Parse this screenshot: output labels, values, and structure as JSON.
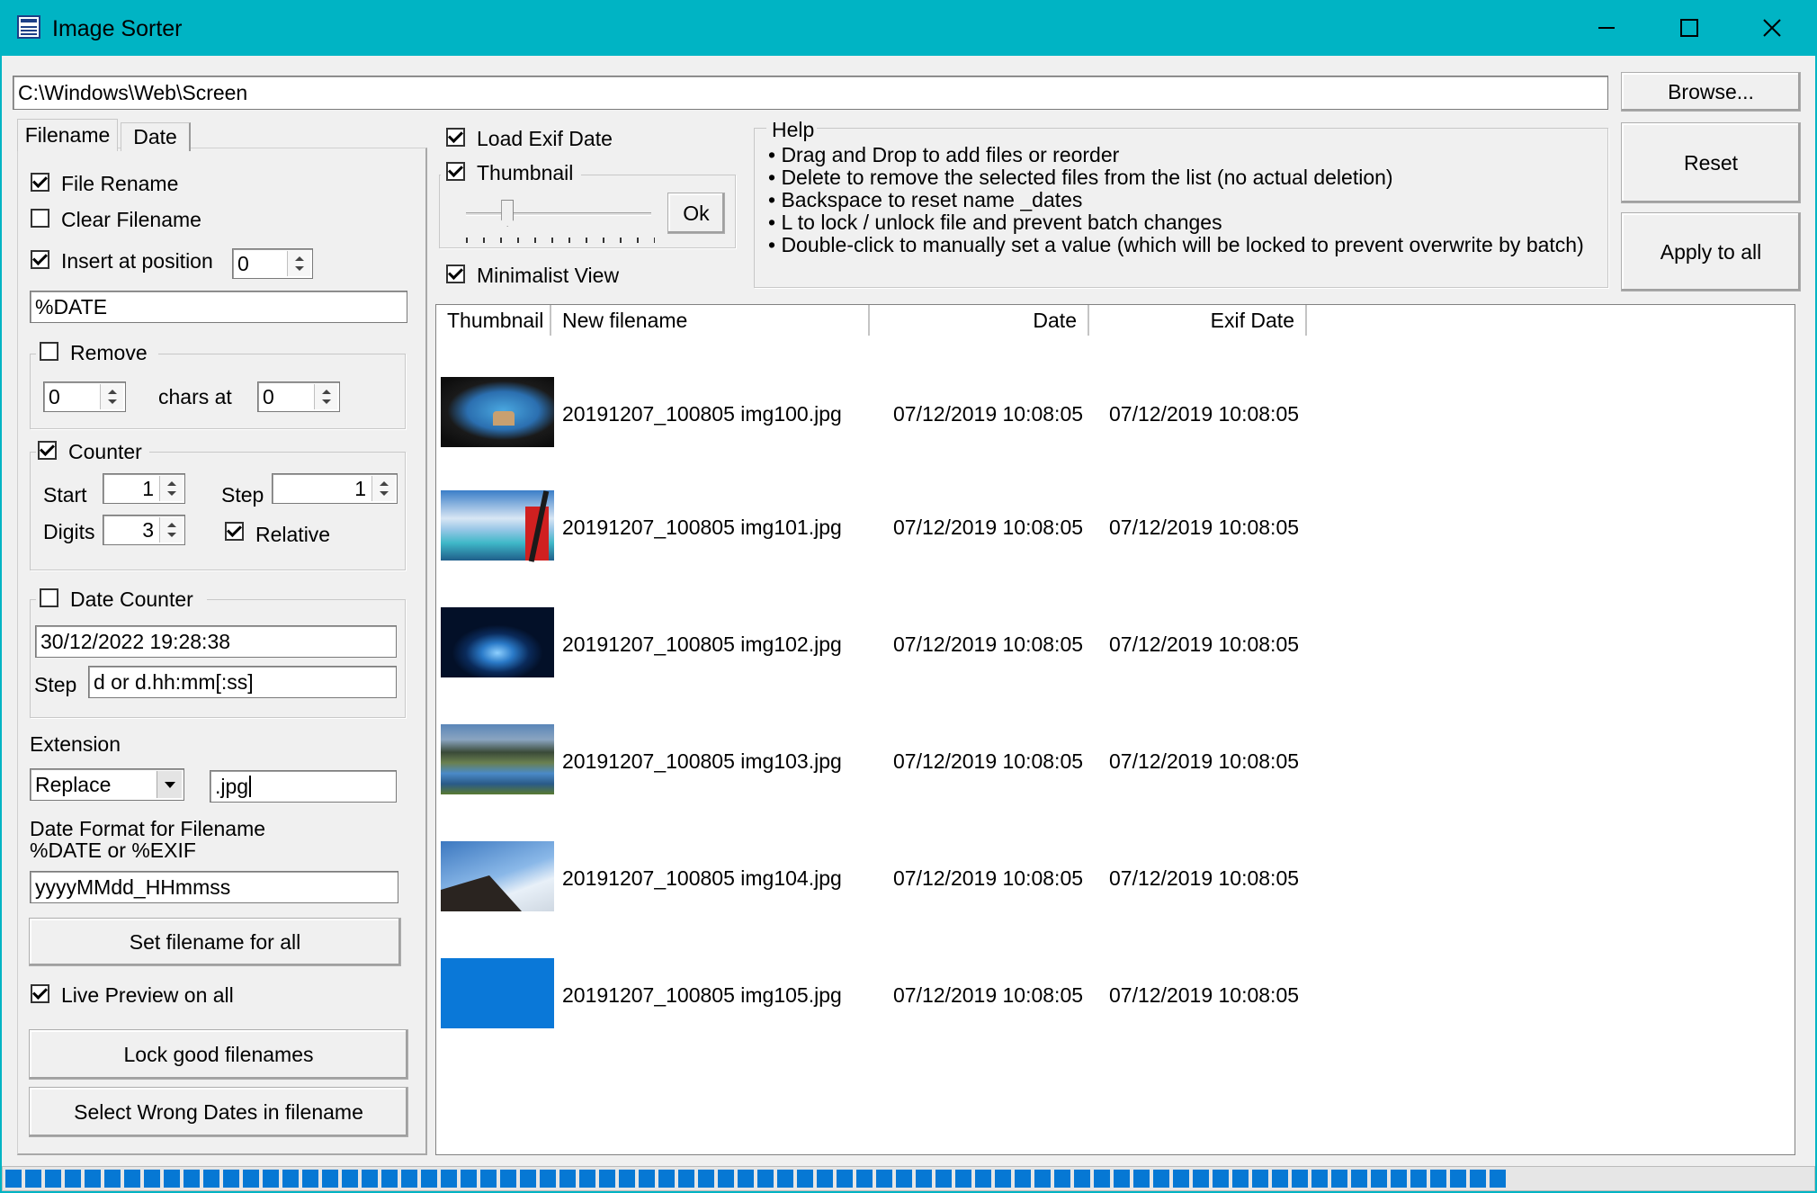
{
  "window": {
    "title": "Image Sorter"
  },
  "path": {
    "value": "C:\\Windows\\Web\\Screen",
    "browse_label": "Browse..."
  },
  "tabs": [
    {
      "label": "Filename",
      "active": true
    },
    {
      "label": "Date",
      "active": false
    }
  ],
  "filename_panel": {
    "file_rename": {
      "label": "File Rename",
      "checked": true
    },
    "clear_filename": {
      "label": "Clear Filename",
      "checked": false
    },
    "insert_at_position": {
      "label": "Insert at position",
      "checked": true,
      "value": "0"
    },
    "pattern": "%DATE",
    "remove": {
      "label": "Remove",
      "checked": false,
      "count": "0",
      "chars_at_label": "chars at",
      "position": "0"
    },
    "counter": {
      "label": "Counter",
      "checked": true,
      "start_label": "Start",
      "start": "1",
      "step_label": "Step",
      "step": "1",
      "digits_label": "Digits",
      "digits": "3",
      "relative_label": "Relative",
      "relative_checked": true
    },
    "date_counter": {
      "label": "Date Counter",
      "checked": false,
      "value": "30/12/2022 19:28:38",
      "step_label": "Step",
      "step_value": "d or d.hh:mm[:ss]"
    },
    "extension": {
      "label": "Extension",
      "mode": "Replace",
      "value": ".jpg"
    },
    "date_format": {
      "label_line1": "Date Format for Filename",
      "label_line2": "%DATE or %EXIF",
      "value": "yyyyMMdd_HHmmss"
    },
    "set_filename_button": "Set filename for all",
    "live_preview": {
      "label": "Live Preview on all",
      "checked": true
    },
    "lock_good_button": "Lock good filenames",
    "select_wrong_button": "Select Wrong Dates in filename"
  },
  "options": {
    "load_exif": {
      "label": "Load Exif Date",
      "checked": true
    },
    "thumbnail": {
      "label": "Thumbnail",
      "checked": true,
      "ok_label": "Ok",
      "slider_level": 0.2
    },
    "minimalist": {
      "label": "Minimalist View",
      "checked": true
    }
  },
  "help": {
    "title": "Help",
    "lines": [
      "• Drag and Drop to add files or reorder",
      "• Delete to remove the selected files from the list (no actual deletion)",
      "• Backspace to reset name _dates",
      "• L to lock / unlock file and prevent batch changes",
      "• Double-click to manually set a value (which will be locked to prevent overwrite by batch)"
    ]
  },
  "actions": {
    "reset_label": "Reset",
    "apply_label": "Apply to all"
  },
  "list": {
    "columns": [
      "Thumbnail",
      "New filename",
      "Date",
      "Exif Date"
    ],
    "rows": [
      {
        "thumbnail": "cave-arch-photo",
        "filename": "20191207_100805 img100.jpg",
        "date": "07/12/2019 10:08:05",
        "exif_date": "07/12/2019 10:08:05"
      },
      {
        "thumbnail": "aerial-lagoon-photo",
        "filename": "20191207_100805 img101.jpg",
        "date": "07/12/2019 10:08:05",
        "exif_date": "07/12/2019 10:08:05"
      },
      {
        "thumbnail": "ice-cave-photo",
        "filename": "20191207_100805 img102.jpg",
        "date": "07/12/2019 10:08:05",
        "exif_date": "07/12/2019 10:08:05"
      },
      {
        "thumbnail": "mountain-lake-photo",
        "filename": "20191207_100805 img103.jpg",
        "date": "07/12/2019 10:08:05",
        "exif_date": "07/12/2019 10:08:05"
      },
      {
        "thumbnail": "hillside-clouds-photo",
        "filename": "20191207_100805 img104.jpg",
        "date": "07/12/2019 10:08:05",
        "exif_date": "07/12/2019 10:08:05"
      },
      {
        "thumbnail": "solid-blue-image",
        "filename": "20191207_100805 img105.jpg",
        "date": "07/12/2019 10:08:05",
        "exif_date": "07/12/2019 10:08:05"
      }
    ]
  },
  "progress": {
    "fraction": 0.84,
    "color": "#0678d4"
  },
  "colors": {
    "titlebar": "#00b4c4",
    "window_bg": "#f0f0f0"
  }
}
